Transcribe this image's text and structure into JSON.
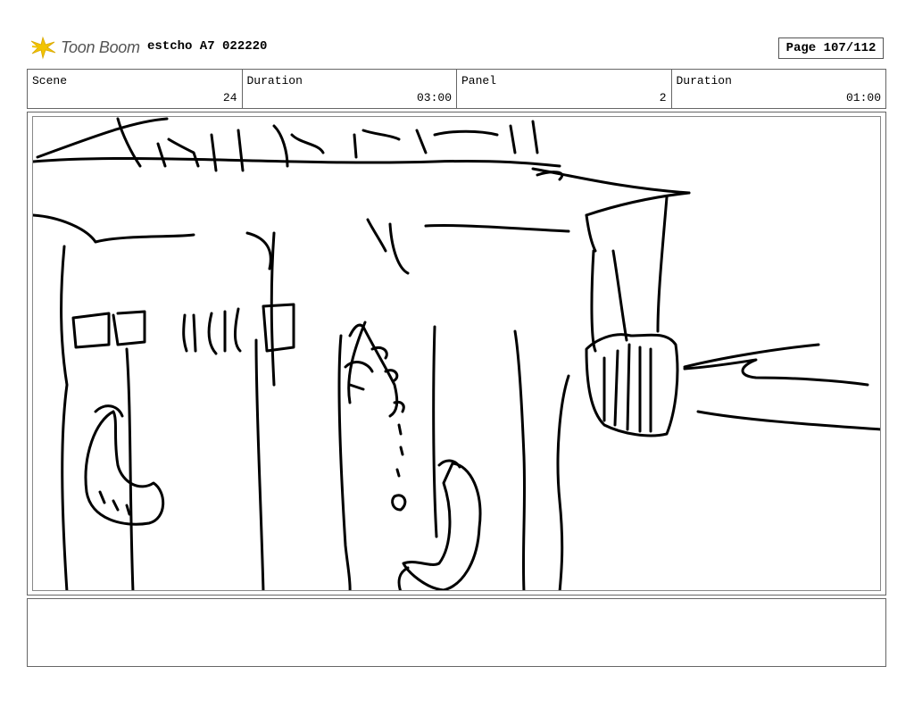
{
  "header": {
    "logo_text": "Toon Boom",
    "project": "estcho A7 022220",
    "page": "Page 107/112"
  },
  "info": {
    "scene_label": "Scene",
    "scene_value": "24",
    "scene_duration_label": "Duration",
    "scene_duration_value": "03:00",
    "panel_label": "Panel",
    "panel_value": "2",
    "panel_duration_label": "Duration",
    "panel_duration_value": "01:00"
  },
  "notes": {
    "text": ""
  },
  "colors": {
    "logo_burst": "#f2c400",
    "border": "#666666"
  }
}
